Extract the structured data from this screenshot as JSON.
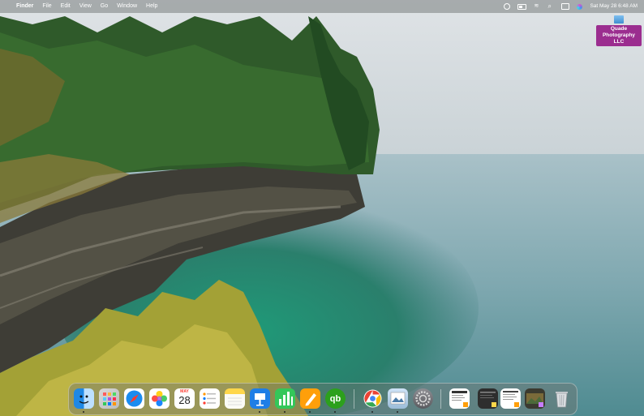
{
  "menubar": {
    "apple_glyph": "",
    "app_name": "Finder",
    "menus": [
      "File",
      "Edit",
      "View",
      "Go",
      "Window",
      "Help"
    ],
    "clock": "Sat May 28  6:48 AM"
  },
  "desktop": {
    "icon_label_line1": "Quade",
    "icon_label_line2": "Photography LLC"
  },
  "dock": {
    "calendar": {
      "month": "MAY",
      "day": "28"
    },
    "quickbooks_glyph": "qb",
    "colors": {
      "finder": "#1e88e5",
      "numbers": "#34c759",
      "pages": "#ff9f0a",
      "quickbooks": "#2ca01c",
      "keynote": "#1e7ee6"
    }
  }
}
